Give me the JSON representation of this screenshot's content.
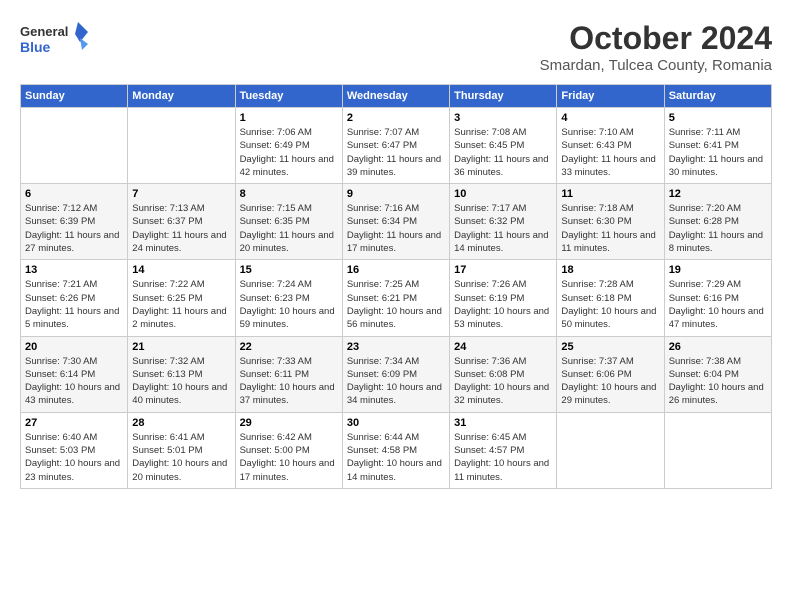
{
  "header": {
    "logo_line1": "General",
    "logo_line2": "Blue",
    "month": "October 2024",
    "location": "Smardan, Tulcea County, Romania"
  },
  "weekdays": [
    "Sunday",
    "Monday",
    "Tuesday",
    "Wednesday",
    "Thursday",
    "Friday",
    "Saturday"
  ],
  "weeks": [
    [
      {
        "day": "",
        "details": ""
      },
      {
        "day": "",
        "details": ""
      },
      {
        "day": "1",
        "details": "Sunrise: 7:06 AM\nSunset: 6:49 PM\nDaylight: 11 hours and 42 minutes."
      },
      {
        "day": "2",
        "details": "Sunrise: 7:07 AM\nSunset: 6:47 PM\nDaylight: 11 hours and 39 minutes."
      },
      {
        "day": "3",
        "details": "Sunrise: 7:08 AM\nSunset: 6:45 PM\nDaylight: 11 hours and 36 minutes."
      },
      {
        "day": "4",
        "details": "Sunrise: 7:10 AM\nSunset: 6:43 PM\nDaylight: 11 hours and 33 minutes."
      },
      {
        "day": "5",
        "details": "Sunrise: 7:11 AM\nSunset: 6:41 PM\nDaylight: 11 hours and 30 minutes."
      }
    ],
    [
      {
        "day": "6",
        "details": "Sunrise: 7:12 AM\nSunset: 6:39 PM\nDaylight: 11 hours and 27 minutes."
      },
      {
        "day": "7",
        "details": "Sunrise: 7:13 AM\nSunset: 6:37 PM\nDaylight: 11 hours and 24 minutes."
      },
      {
        "day": "8",
        "details": "Sunrise: 7:15 AM\nSunset: 6:35 PM\nDaylight: 11 hours and 20 minutes."
      },
      {
        "day": "9",
        "details": "Sunrise: 7:16 AM\nSunset: 6:34 PM\nDaylight: 11 hours and 17 minutes."
      },
      {
        "day": "10",
        "details": "Sunrise: 7:17 AM\nSunset: 6:32 PM\nDaylight: 11 hours and 14 minutes."
      },
      {
        "day": "11",
        "details": "Sunrise: 7:18 AM\nSunset: 6:30 PM\nDaylight: 11 hours and 11 minutes."
      },
      {
        "day": "12",
        "details": "Sunrise: 7:20 AM\nSunset: 6:28 PM\nDaylight: 11 hours and 8 minutes."
      }
    ],
    [
      {
        "day": "13",
        "details": "Sunrise: 7:21 AM\nSunset: 6:26 PM\nDaylight: 11 hours and 5 minutes."
      },
      {
        "day": "14",
        "details": "Sunrise: 7:22 AM\nSunset: 6:25 PM\nDaylight: 11 hours and 2 minutes."
      },
      {
        "day": "15",
        "details": "Sunrise: 7:24 AM\nSunset: 6:23 PM\nDaylight: 10 hours and 59 minutes."
      },
      {
        "day": "16",
        "details": "Sunrise: 7:25 AM\nSunset: 6:21 PM\nDaylight: 10 hours and 56 minutes."
      },
      {
        "day": "17",
        "details": "Sunrise: 7:26 AM\nSunset: 6:19 PM\nDaylight: 10 hours and 53 minutes."
      },
      {
        "day": "18",
        "details": "Sunrise: 7:28 AM\nSunset: 6:18 PM\nDaylight: 10 hours and 50 minutes."
      },
      {
        "day": "19",
        "details": "Sunrise: 7:29 AM\nSunset: 6:16 PM\nDaylight: 10 hours and 47 minutes."
      }
    ],
    [
      {
        "day": "20",
        "details": "Sunrise: 7:30 AM\nSunset: 6:14 PM\nDaylight: 10 hours and 43 minutes."
      },
      {
        "day": "21",
        "details": "Sunrise: 7:32 AM\nSunset: 6:13 PM\nDaylight: 10 hours and 40 minutes."
      },
      {
        "day": "22",
        "details": "Sunrise: 7:33 AM\nSunset: 6:11 PM\nDaylight: 10 hours and 37 minutes."
      },
      {
        "day": "23",
        "details": "Sunrise: 7:34 AM\nSunset: 6:09 PM\nDaylight: 10 hours and 34 minutes."
      },
      {
        "day": "24",
        "details": "Sunrise: 7:36 AM\nSunset: 6:08 PM\nDaylight: 10 hours and 32 minutes."
      },
      {
        "day": "25",
        "details": "Sunrise: 7:37 AM\nSunset: 6:06 PM\nDaylight: 10 hours and 29 minutes."
      },
      {
        "day": "26",
        "details": "Sunrise: 7:38 AM\nSunset: 6:04 PM\nDaylight: 10 hours and 26 minutes."
      }
    ],
    [
      {
        "day": "27",
        "details": "Sunrise: 6:40 AM\nSunset: 5:03 PM\nDaylight: 10 hours and 23 minutes."
      },
      {
        "day": "28",
        "details": "Sunrise: 6:41 AM\nSunset: 5:01 PM\nDaylight: 10 hours and 20 minutes."
      },
      {
        "day": "29",
        "details": "Sunrise: 6:42 AM\nSunset: 5:00 PM\nDaylight: 10 hours and 17 minutes."
      },
      {
        "day": "30",
        "details": "Sunrise: 6:44 AM\nSunset: 4:58 PM\nDaylight: 10 hours and 14 minutes."
      },
      {
        "day": "31",
        "details": "Sunrise: 6:45 AM\nSunset: 4:57 PM\nDaylight: 10 hours and 11 minutes."
      },
      {
        "day": "",
        "details": ""
      },
      {
        "day": "",
        "details": ""
      }
    ]
  ]
}
